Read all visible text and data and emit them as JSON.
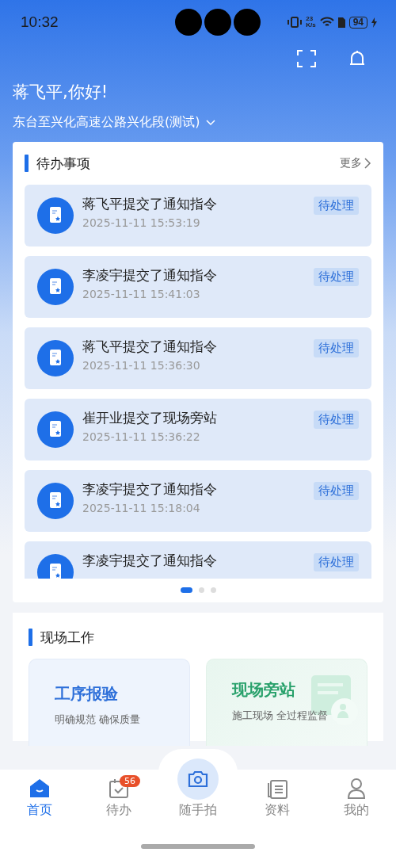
{
  "status_bar": {
    "time": "10:32",
    "net_speed": "23",
    "net_unit": "K/s",
    "battery": "94"
  },
  "header": {
    "greeting": "蒋飞平,你好!",
    "project": "东台至兴化高速公路兴化段(测试)"
  },
  "todo": {
    "title": "待办事项",
    "more": "更多",
    "items": [
      {
        "title": "蒋飞平提交了通知指令",
        "time": "2025-11-11 15:53:19",
        "status": "待处理"
      },
      {
        "title": "李凌宇提交了通知指令",
        "time": "2025-11-11 15:41:03",
        "status": "待处理"
      },
      {
        "title": "蒋飞平提交了通知指令",
        "time": "2025-11-11 15:36:30",
        "status": "待处理"
      },
      {
        "title": "崔开业提交了现场旁站",
        "time": "2025-11-11 15:36:22",
        "status": "待处理"
      },
      {
        "title": "李凌宇提交了通知指令",
        "time": "2025-11-11 15:18:04",
        "status": "待处理"
      },
      {
        "title": "李凌宇提交了通知指令",
        "status": "待处理"
      }
    ],
    "pages": [
      {
        "selected": true
      },
      {
        "selected": false
      },
      {
        "selected": false
      }
    ]
  },
  "field_work": {
    "title": "现场工作",
    "cards": [
      {
        "kind": "blue",
        "title": "工序报验",
        "subtitle": "明确规范 确保质量"
      },
      {
        "kind": "green",
        "title": "现场旁站",
        "subtitle": "施工现场 全过程监督"
      }
    ]
  },
  "tabs": [
    {
      "kind": "home",
      "label": "首页",
      "selected": true
    },
    {
      "kind": "todo",
      "label": "待办",
      "selected": false,
      "badge": "56"
    },
    {
      "kind": "camera",
      "label": "随手拍",
      "selected": false
    },
    {
      "kind": "docs",
      "label": "资料",
      "selected": false
    },
    {
      "kind": "profile",
      "label": "我的",
      "selected": false
    }
  ]
}
